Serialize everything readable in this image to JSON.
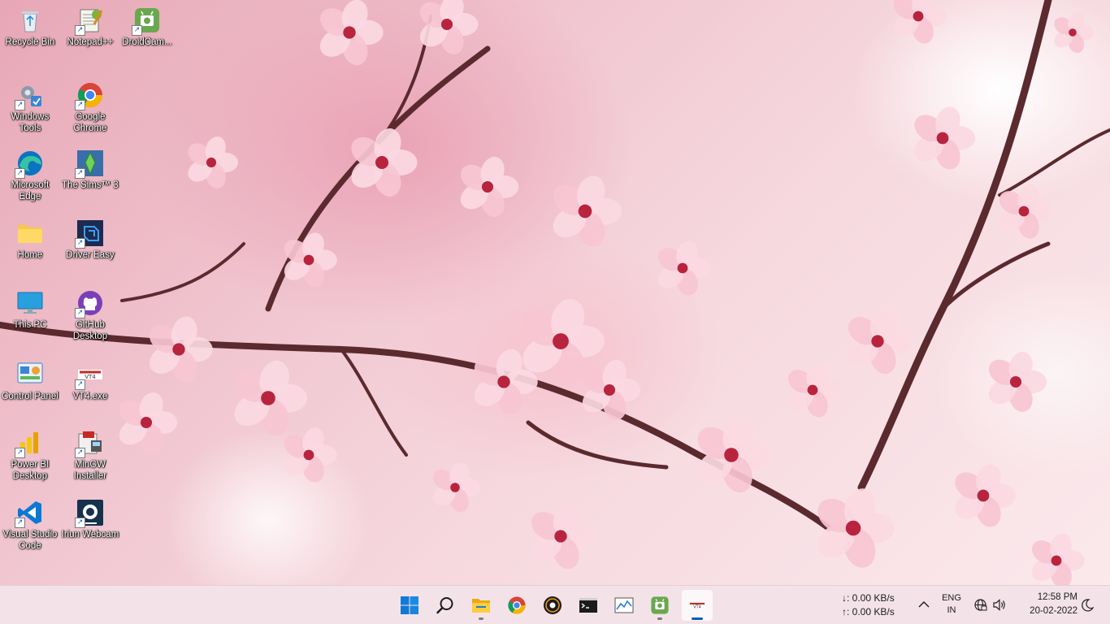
{
  "desktop_icons": [
    {
      "name": "recycle-bin",
      "label": "Recycle Bin",
      "icon": "recycle-bin-icon"
    },
    {
      "name": "notepad-plus-plus",
      "label": "Notepad++",
      "icon": "notepad-plus-plus-icon"
    },
    {
      "name": "droidcam",
      "label": "DroidCam...",
      "icon": "droidcam-icon"
    },
    {
      "name": "windows-tools",
      "label": "Windows Tools",
      "icon": "windows-tools-icon"
    },
    {
      "name": "google-chrome",
      "label": "Google Chrome",
      "icon": "chrome-icon"
    },
    {
      "name": "microsoft-edge",
      "label": "Microsoft Edge",
      "icon": "edge-icon"
    },
    {
      "name": "the-sims-3",
      "label": "The Sims™ 3",
      "icon": "sims-icon"
    },
    {
      "name": "home",
      "label": "Home",
      "icon": "folder-icon"
    },
    {
      "name": "driver-easy",
      "label": "Driver Easy",
      "icon": "driver-easy-icon"
    },
    {
      "name": "this-pc",
      "label": "This PC",
      "icon": "monitor-icon"
    },
    {
      "name": "github-desktop",
      "label": "GitHub Desktop",
      "icon": "github-icon"
    },
    {
      "name": "control-panel",
      "label": "Control Panel",
      "icon": "control-panel-icon"
    },
    {
      "name": "vt4-exe",
      "label": "VT4.exe",
      "icon": "vt4-icon"
    },
    {
      "name": "power-bi-desktop",
      "label": "Power BI Desktop",
      "icon": "power-bi-icon"
    },
    {
      "name": "mingw-installer",
      "label": "MinGW Installer",
      "icon": "mingw-icon"
    },
    {
      "name": "visual-studio-code",
      "label": "Visual Studio Code",
      "icon": "vscode-icon"
    },
    {
      "name": "iriun-webcam",
      "label": "Iriun Webcam",
      "icon": "iriun-webcam-icon"
    }
  ],
  "taskbar": {
    "apps": [
      {
        "name": "start",
        "icon": "windows-start-icon"
      },
      {
        "name": "search",
        "icon": "search-icon"
      },
      {
        "name": "file-explorer",
        "icon": "file-explorer-icon"
      },
      {
        "name": "chrome",
        "icon": "chrome-icon"
      },
      {
        "name": "media-player",
        "icon": "media-player-icon"
      },
      {
        "name": "terminal",
        "icon": "terminal-icon"
      },
      {
        "name": "performance-monitor",
        "icon": "performance-icon"
      },
      {
        "name": "droidcam",
        "icon": "droidcam-icon"
      },
      {
        "name": "vt4",
        "icon": "vt4-icon"
      }
    ],
    "network_speed": {
      "download": "↓: 0.00 KB/s",
      "upload": "↑: 0.00 KB/s"
    },
    "language": {
      "line1": "ENG",
      "line2": "IN"
    },
    "clock": {
      "time": "12:58 PM",
      "date": "20-02-2022"
    },
    "colors": {
      "taskbar_bg": "#f3e3e8",
      "active_indicator": "#005fb8"
    }
  }
}
